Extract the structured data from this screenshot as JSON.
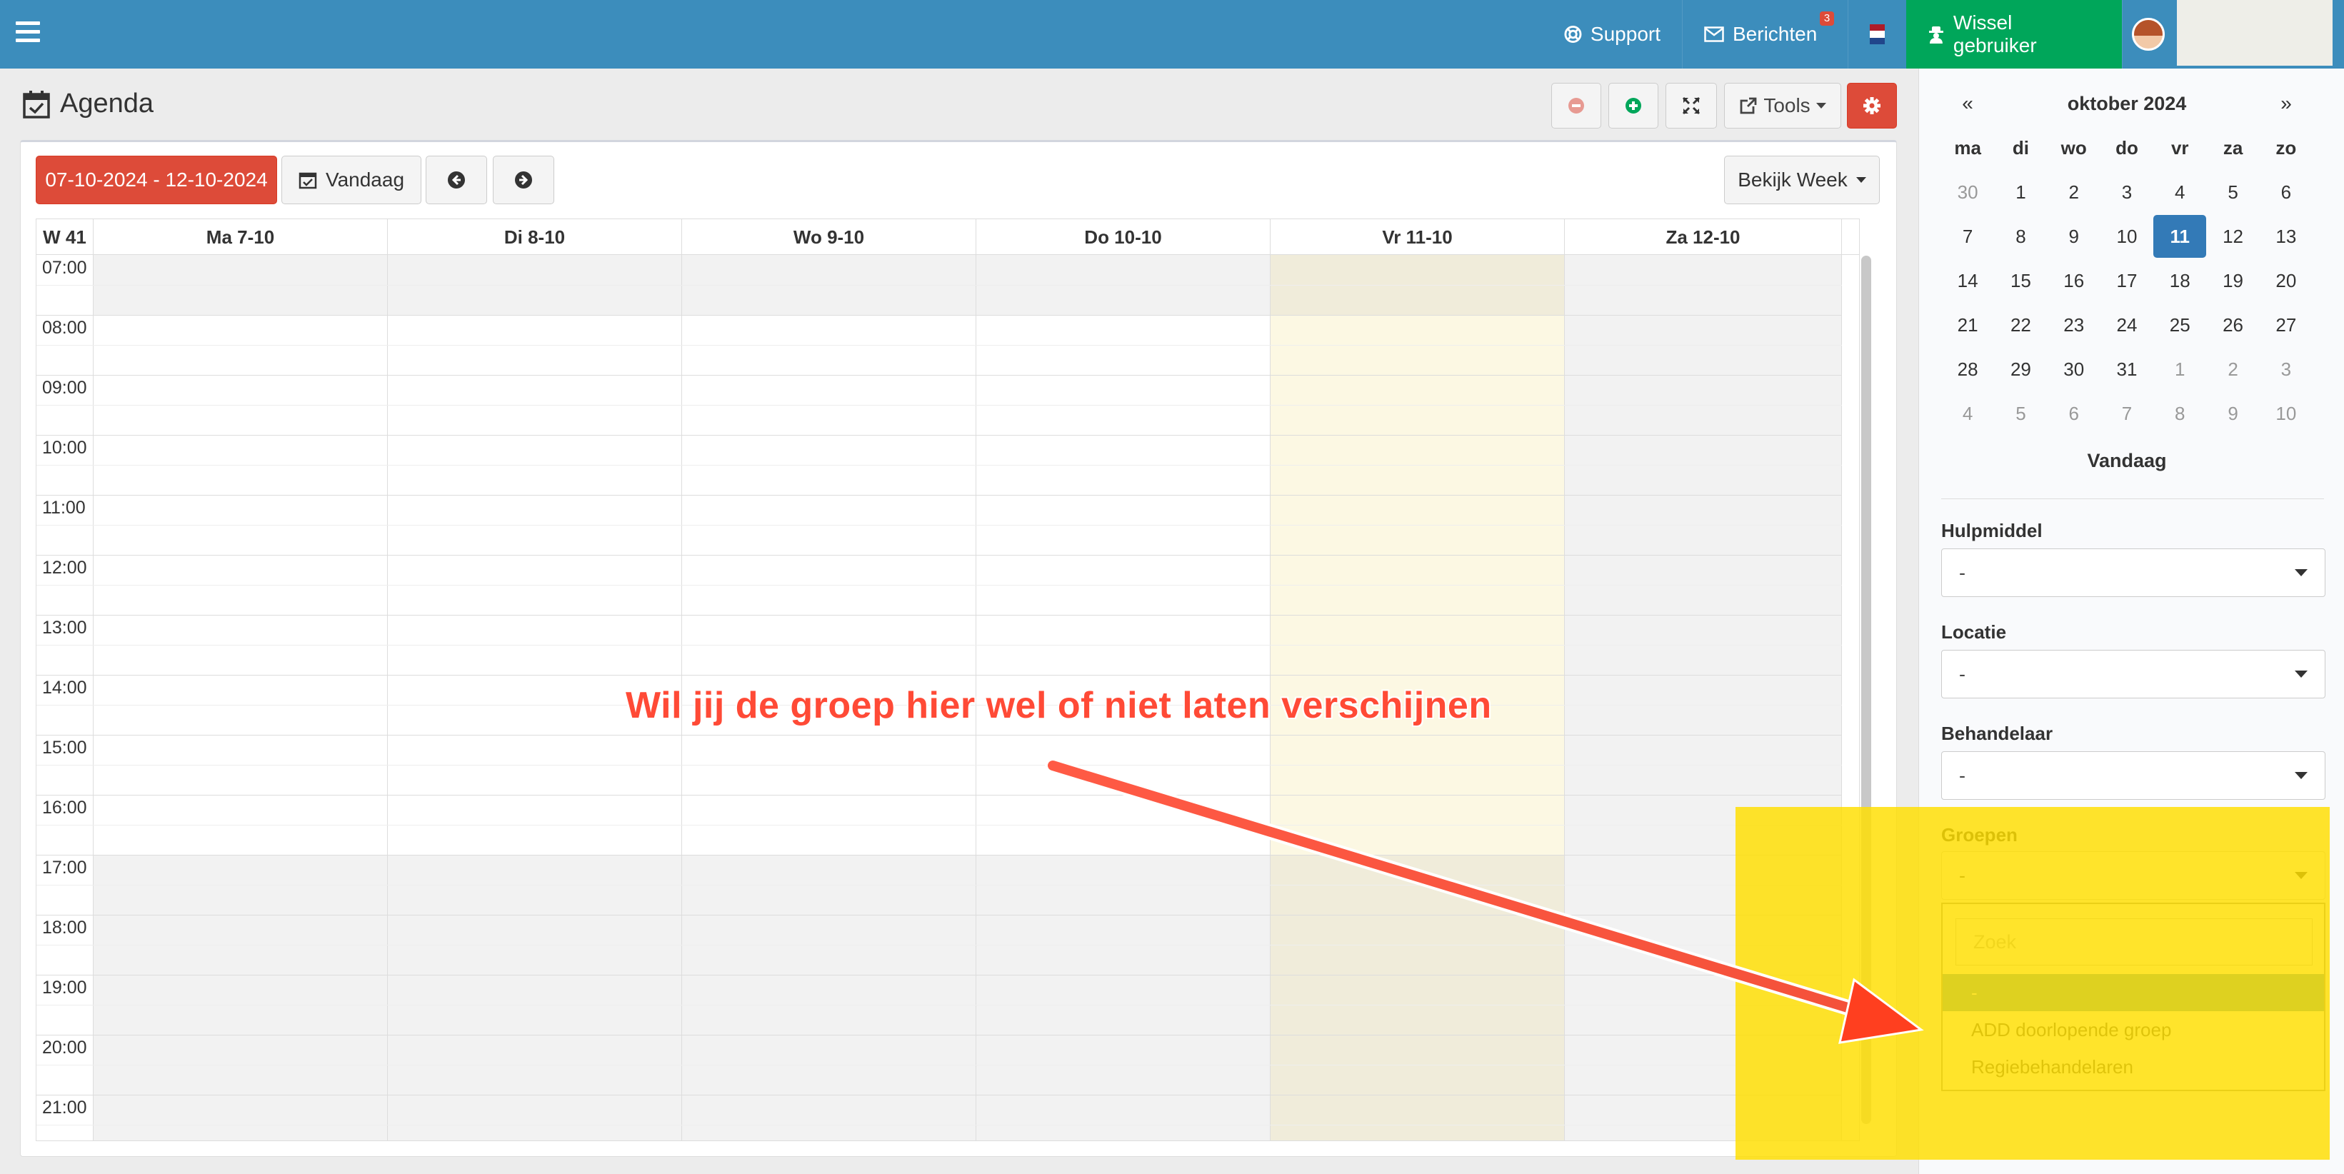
{
  "topbar": {
    "support_label": "Support",
    "messages_label": "Berichten",
    "messages_badge": "3",
    "switch_user_label": "Wissel gebruiker",
    "flag_colors": [
      "#ae1c28",
      "#ffffff",
      "#21468b"
    ]
  },
  "page": {
    "title": "Agenda"
  },
  "toolbar": {
    "tools_label": "Tools"
  },
  "nav": {
    "date_range": "07-10-2024 - 12-10-2024",
    "today_label": "Vandaag",
    "view_label": "Bekijk Week"
  },
  "calendar": {
    "week_label": "W 41",
    "days": [
      "Ma 7-10",
      "Di 8-10",
      "Wo 9-10",
      "Do 10-10",
      "Vr 11-10",
      "Za 12-10"
    ],
    "times": [
      "07:00",
      "08:00",
      "09:00",
      "10:00",
      "11:00",
      "12:00",
      "13:00",
      "14:00",
      "15:00",
      "16:00",
      "17:00",
      "18:00",
      "19:00",
      "20:00",
      "21:00"
    ]
  },
  "annotation": {
    "text": "Wil jij de groep hier wel of niet laten verschijnen",
    "highlight_color": "#ffde00",
    "arrow_color": "#f4513a"
  },
  "mini_calendar": {
    "prev": "«",
    "next": "»",
    "month_label": "oktober 2024",
    "weekdays": [
      "ma",
      "di",
      "wo",
      "do",
      "vr",
      "za",
      "zo"
    ],
    "weeks": [
      [
        "30",
        "1",
        "2",
        "3",
        "4",
        "5",
        "6"
      ],
      [
        "7",
        "8",
        "9",
        "10",
        "11",
        "12",
        "13"
      ],
      [
        "14",
        "15",
        "16",
        "17",
        "18",
        "19",
        "20"
      ],
      [
        "21",
        "22",
        "23",
        "24",
        "25",
        "26",
        "27"
      ],
      [
        "28",
        "29",
        "30",
        "31",
        "1",
        "2",
        "3"
      ],
      [
        "4",
        "5",
        "6",
        "7",
        "8",
        "9",
        "10"
      ]
    ],
    "selected": "11",
    "today_label": "Vandaag"
  },
  "filters": {
    "hulpmiddel": {
      "label": "Hulpmiddel",
      "value": "-"
    },
    "locatie": {
      "label": "Locatie",
      "value": "-"
    },
    "behandelaar": {
      "label": "Behandelaar",
      "value": "-"
    },
    "groepen": {
      "label": "Groepen",
      "value": "-",
      "search_placeholder": "Zoek",
      "options": [
        "-",
        "ADD doorlopende groep",
        "Regiebehandelaren"
      ]
    }
  }
}
